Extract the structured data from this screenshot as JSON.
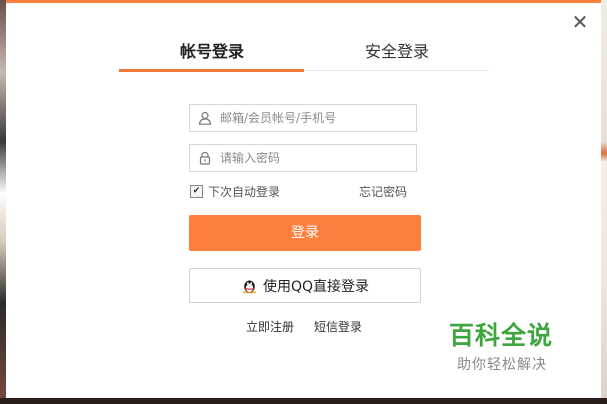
{
  "dialog": {
    "close_glyph": "✕",
    "tabs": [
      {
        "label": "帐号登录",
        "active": true
      },
      {
        "label": "安全登录",
        "active": false
      }
    ],
    "username": {
      "placeholder": "邮箱/会员帐号/手机号",
      "value": "",
      "icon": "user-icon"
    },
    "password": {
      "placeholder": "请输入密码",
      "value": "",
      "icon": "lock-icon"
    },
    "remember_label": "下次自动登录",
    "remember_checked": true,
    "forgot_label": "忘记密码",
    "login_label": "登录",
    "qq_login_label": "使用QQ直接登录",
    "register_label": "立即注册",
    "sms_login_label": "短信登录"
  },
  "watermark": {
    "title": "百科全说",
    "subtitle": "助你轻松解决"
  },
  "colors": {
    "accent": "#ff7f3f",
    "tab_underline": "#f07838",
    "watermark_green": "#3fa63f"
  }
}
